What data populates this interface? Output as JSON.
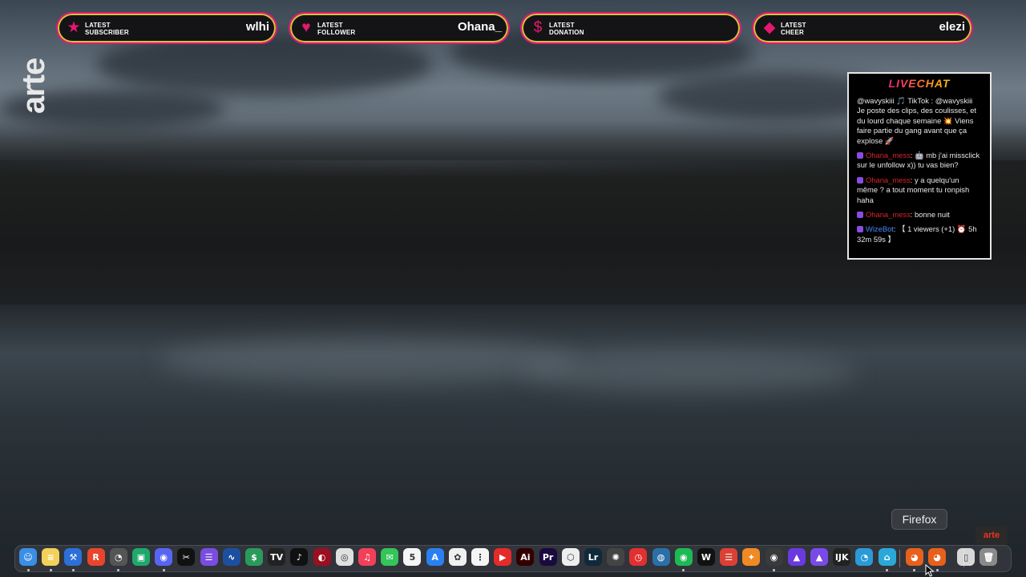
{
  "alerts": [
    {
      "label_1": "LATEST",
      "label_2": "SUBSCRIBER",
      "value": "wlhi",
      "icon": "star-icon",
      "glyph": "★"
    },
    {
      "label_1": "LATEST",
      "label_2": "FOLLOWER",
      "value": "Ohana_",
      "icon": "heart-icon",
      "glyph": "♥"
    },
    {
      "label_1": "LATEST",
      "label_2": "DONATION",
      "value": "",
      "icon": "dollar-icon",
      "glyph": "$"
    },
    {
      "label_1": "LATEST",
      "label_2": "CHEER",
      "value": "elezi",
      "icon": "diamond-icon",
      "glyph": "◆"
    }
  ],
  "brand": {
    "logo": "arte",
    "mini_logo": "arte"
  },
  "chat": {
    "title": "LIVECHAT",
    "messages": [
      {
        "user": "",
        "text": "@wavyskiii 🎵 TikTok : @wavyskiii Je poste des clips, des coulisses, et du lourd chaque semaine 💥 Viens faire partie du gang avant que ça explose 🚀"
      },
      {
        "user": "Ohana_mess",
        "text": ": 🤖 mb j'ai missclick sur le unfollow x)) tu vas bien?"
      },
      {
        "user": "Ohana_mess",
        "text": ": y a quelqu'un même ? a tout moment tu ronpish haha"
      },
      {
        "user": "Ohana_mess",
        "text": ": bonne nuit"
      },
      {
        "user": "WizeBot",
        "text": ": 【 1 viewers (+1) ⏰ 5h 32m 59s 】"
      }
    ]
  },
  "tooltip": {
    "text": "Firefox"
  },
  "dock": {
    "apps": [
      {
        "name": "finder",
        "glyph": "☺",
        "bg": "#3a8ee6"
      },
      {
        "name": "notes",
        "glyph": "≡",
        "bg": "#f2d15a"
      },
      {
        "name": "xcode",
        "glyph": "⚒",
        "bg": "#2d6fd8"
      },
      {
        "name": "readkit",
        "glyph": "R",
        "bg": "#e8452c"
      },
      {
        "name": "activity-monitor",
        "glyph": "◔",
        "bg": "#555"
      },
      {
        "name": "screen-share",
        "glyph": "▣",
        "bg": "#1fa86b"
      },
      {
        "name": "discord",
        "glyph": "◉",
        "bg": "#5865f2"
      },
      {
        "name": "capcut",
        "glyph": "✂",
        "bg": "#111"
      },
      {
        "name": "mimestream",
        "glyph": "☰",
        "bg": "#7a4de0"
      },
      {
        "name": "stocks",
        "glyph": "∿",
        "bg": "#1c4fa0"
      },
      {
        "name": "money",
        "glyph": "$",
        "bg": "#2a9a5a"
      },
      {
        "name": "tradingview",
        "glyph": "TV",
        "bg": "#222"
      },
      {
        "name": "tiktok",
        "glyph": "♪",
        "bg": "#111"
      },
      {
        "name": "red-app",
        "glyph": "◐",
        "bg": "#9a1020"
      },
      {
        "name": "chrome",
        "glyph": "◎",
        "bg": "#e0e0e0"
      },
      {
        "name": "music",
        "glyph": "♫",
        "bg": "#f2405a"
      },
      {
        "name": "messages",
        "glyph": "✉",
        "bg": "#33c45a"
      },
      {
        "name": "calendar",
        "glyph": "5",
        "bg": "#f5f5f5"
      },
      {
        "name": "app-store",
        "glyph": "A",
        "bg": "#2a80f0"
      },
      {
        "name": "photos",
        "glyph": "✿",
        "bg": "#f0f0f0"
      },
      {
        "name": "reminders",
        "glyph": "⋮",
        "bg": "#f5f5f5"
      },
      {
        "name": "red-square",
        "glyph": "▶",
        "bg": "#e52a2a"
      },
      {
        "name": "illustrator",
        "glyph": "Ai",
        "bg": "#330000"
      },
      {
        "name": "premiere",
        "glyph": "Pr",
        "bg": "#1a0a40"
      },
      {
        "name": "unity",
        "glyph": "⬡",
        "bg": "#eee"
      },
      {
        "name": "lightroom",
        "glyph": "Lr",
        "bg": "#0f2a3a"
      },
      {
        "name": "chatgpt",
        "glyph": "✺",
        "bg": "#444"
      },
      {
        "name": "timer",
        "glyph": "◷",
        "bg": "#e03030"
      },
      {
        "name": "proxyman",
        "glyph": "◍",
        "bg": "#2a6fa8"
      },
      {
        "name": "spotify",
        "glyph": "◉",
        "bg": "#1db954"
      },
      {
        "name": "waves",
        "glyph": "W",
        "bg": "#111"
      },
      {
        "name": "todoist",
        "glyph": "☰",
        "bg": "#db4035"
      },
      {
        "name": "fl-studio",
        "glyph": "✦",
        "bg": "#f08a24"
      },
      {
        "name": "obs",
        "glyph": "◉",
        "bg": "#3a3a3a"
      },
      {
        "name": "arc-purple",
        "glyph": "▲",
        "bg": "#6a3ae0"
      },
      {
        "name": "arc-purple-2",
        "glyph": "▲",
        "bg": "#7a4ae8"
      },
      {
        "name": "logi",
        "glyph": "IJK",
        "bg": "#222"
      },
      {
        "name": "aquarium",
        "glyph": "◔",
        "bg": "#2a9ad8"
      },
      {
        "name": "hyperjoin",
        "glyph": "⌂",
        "bg": "#2aa8d8"
      },
      {
        "name": "firefox",
        "glyph": "◕",
        "bg": "#e8601c"
      },
      {
        "name": "firefox-dev",
        "glyph": "◕",
        "bg": "#e8601c"
      },
      {
        "name": "folder-doc",
        "glyph": "▯",
        "bg": "#d8d8d8"
      },
      {
        "name": "trash",
        "glyph": "🗑",
        "bg": "#8a8a8a"
      }
    ]
  }
}
